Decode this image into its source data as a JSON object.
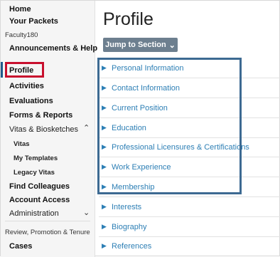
{
  "sidebar": {
    "home": "Home",
    "packets": "Your Packets",
    "section_faculty": "Faculty180",
    "announcements": "Announcements & Help",
    "profile": "Profile",
    "activities": "Activities",
    "evaluations": "Evaluations",
    "forms": "Forms & Reports",
    "vitas": "Vitas & Biosketches",
    "vitas_sub": "Vitas",
    "templates": "My Templates",
    "legacy": "Legacy Vitas",
    "colleagues": "Find Colleagues",
    "account": "Account Access",
    "admin": "Administration",
    "section_rpt": "Review, Promotion & Tenure",
    "cases": "Cases"
  },
  "main": {
    "title": "Profile",
    "jump_label": "Jump to Section",
    "sections": [
      "Personal Information",
      "Contact Information",
      "Current Position",
      "Education",
      "Professional Licensures & Certifications",
      "Work Experience",
      "Membership",
      "Interests",
      "Biography",
      "References"
    ]
  }
}
